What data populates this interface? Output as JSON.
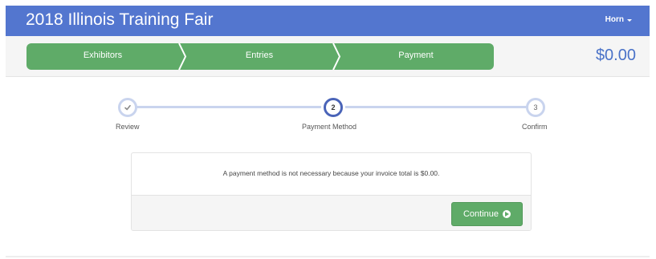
{
  "header": {
    "title": "2018 Illinois Training Fair",
    "user_label": "Horn"
  },
  "wizard": {
    "steps": [
      {
        "label": "Exhibitors"
      },
      {
        "label": "Entries"
      },
      {
        "label": "Payment"
      }
    ],
    "total": "$0.00"
  },
  "progress": {
    "steps": [
      {
        "number": "",
        "label": "Review",
        "state": "done"
      },
      {
        "number": "2",
        "label": "Payment Method",
        "state": "current"
      },
      {
        "number": "3",
        "label": "Confirm",
        "state": "pending"
      }
    ]
  },
  "panel": {
    "message": "A payment method is not necessary because your invoice total is $0.00.",
    "continue_label": "Continue"
  },
  "icons": {
    "user_menu": "caret-down-icon",
    "review_done": "check-icon",
    "continue": "circle-arrow-right-icon"
  },
  "colors": {
    "header_bg": "#5376cf",
    "wizard_green": "#5fab68",
    "total_blue": "#4a72c8",
    "progress_track": "#c9d4ee",
    "progress_current": "#4a64b8"
  }
}
